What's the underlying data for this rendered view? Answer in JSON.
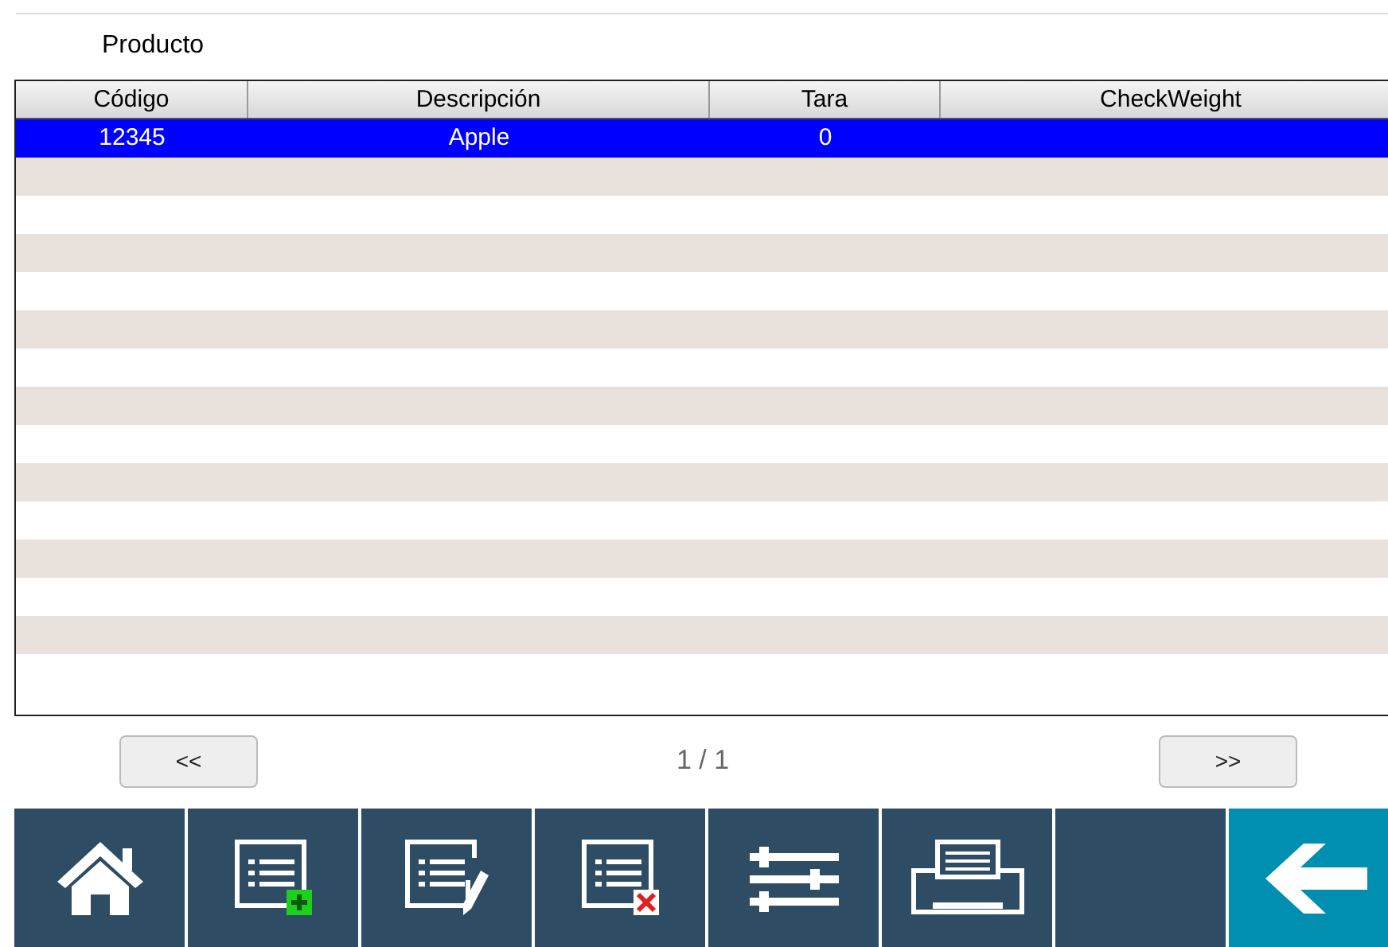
{
  "title": "Producto",
  "table": {
    "columns": [
      "Código",
      "Descripción",
      "Tara",
      "CheckWeight"
    ],
    "rows": [
      {
        "cells": [
          "12345",
          "Apple",
          "0",
          ""
        ],
        "selected": true
      }
    ]
  },
  "pager": {
    "prev": "<<",
    "page": "1 / 1",
    "next": ">>"
  },
  "toolbar": [
    {
      "kind": "home",
      "selected": false
    },
    {
      "kind": "add",
      "selected": false
    },
    {
      "kind": "edit",
      "selected": false
    },
    {
      "kind": "delete",
      "selected": false
    },
    {
      "kind": "settings",
      "selected": false
    },
    {
      "kind": "print",
      "selected": false
    },
    {
      "kind": "blank",
      "selected": false
    },
    {
      "kind": "back",
      "selected": true
    }
  ]
}
